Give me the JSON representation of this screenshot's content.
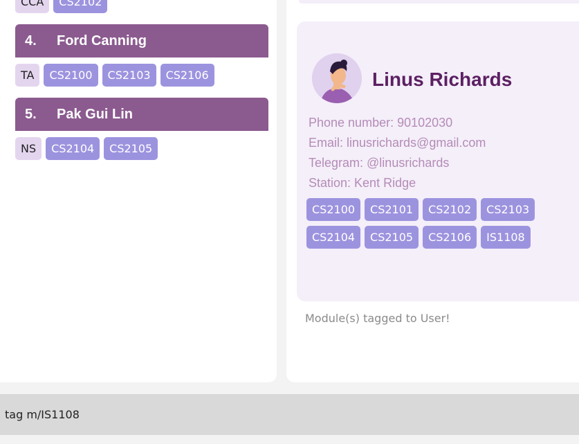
{
  "people": [
    {
      "index": "4.",
      "name": "Ford Canning",
      "role_tag": "TA",
      "modules": [
        "CS2100",
        "CS2103",
        "CS2106"
      ]
    },
    {
      "index": "5.",
      "name": "Pak Gui Lin",
      "role_tag": "NS",
      "modules": [
        "CS2104",
        "CS2105"
      ]
    }
  ],
  "partial_row": {
    "role_tag": "CCA",
    "modules": [
      "CS2102"
    ]
  },
  "detail": {
    "name": "Linus Richards",
    "phone": "Phone number: 90102030",
    "email": "Email: linusrichards@gmail.com",
    "telegram": "Telegram: @linusrichards",
    "station": "Station: Kent Ridge",
    "modules_row1": [
      "CS2100",
      "CS2101",
      "CS2102",
      "CS2103"
    ],
    "modules_row2": [
      "CS2104",
      "CS2105",
      "CS2106",
      "IS1108"
    ]
  },
  "result_message": "Module(s) tagged to User!",
  "command_input": {
    "value": "tag m/IS1108"
  },
  "colors": {
    "header": "#8b5a8f",
    "module_tag": "#9c93df",
    "role_tag": "#e4d5ef",
    "name_text": "#5c1f63",
    "info_text": "#b58bb7"
  }
}
